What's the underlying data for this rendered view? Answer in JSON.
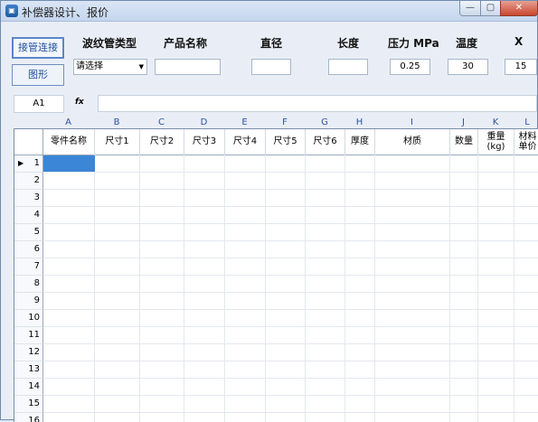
{
  "window": {
    "title": "补偿器设计、报价",
    "icon": "app-icon",
    "controls": {
      "minimize": "—",
      "maximize": "▢",
      "close": "✕"
    }
  },
  "sidebar": {
    "buttons": [
      {
        "label": "接管连接",
        "active": true
      },
      {
        "label": "图形",
        "active": false
      }
    ]
  },
  "form": {
    "labels": {
      "type": "波纹管类型",
      "product": "产品名称",
      "diameter": "直径",
      "length": "长度",
      "pressure": "压力 MPa",
      "temperature": "温度",
      "x": "X"
    },
    "type_select": {
      "value": "请选择"
    },
    "product_value": "",
    "diameter_value": "",
    "length_value": "",
    "pressure_value": "0.25",
    "temperature_value": "30",
    "x_value": "15"
  },
  "formula_bar": {
    "cell_ref": "A1",
    "fx_label": "fx",
    "formula": ""
  },
  "sheet": {
    "column_letters": [
      "A",
      "B",
      "C",
      "D",
      "E",
      "F",
      "G",
      "H",
      "I",
      "J",
      "K",
      "L"
    ],
    "headers": [
      "零件名称",
      "尺寸1",
      "尺寸2",
      "尺寸3",
      "尺寸4",
      "尺寸5",
      "尺寸6",
      "厚度",
      "材质",
      "数量",
      "重量\n(kg)",
      "材料\n单价"
    ],
    "header_lines": {
      "weight": [
        "重量",
        "(kg)"
      ],
      "unit_price": [
        "材料",
        "单价"
      ]
    },
    "rows": [
      "1",
      "2",
      "3",
      "4",
      "5",
      "6",
      "7",
      "8",
      "9",
      "10",
      "11",
      "12",
      "13",
      "14",
      "15",
      "16"
    ],
    "selected_cell": "A1",
    "accent_color": "#3b86d6"
  }
}
